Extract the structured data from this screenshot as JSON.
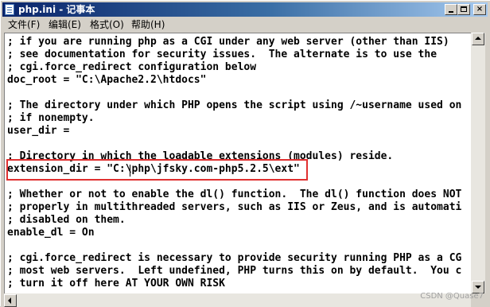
{
  "window": {
    "title": "php.ini - 记事本",
    "minimize_label": "",
    "maximize_label": "",
    "close_label": "×"
  },
  "menu": {
    "items": [
      {
        "label": "文件(F)"
      },
      {
        "label": "编辑(E)"
      },
      {
        "label": "格式(O)"
      },
      {
        "label": "帮助(H)"
      }
    ]
  },
  "editor": {
    "lines": [
      "; if you are running php as a CGI under any web server (other than IIS)",
      "; see documentation for security issues.  The alternate is to use the",
      "; cgi.force_redirect configuration below",
      "doc_root = \"C:\\Apache2.2\\htdocs\"",
      "",
      "; The directory under which PHP opens the script using /~username used on",
      "; if nonempty.",
      "user_dir =",
      "",
      "; Directory in which the loadable extensions (modules) reside.",
      "extension_dir = \"C:\\php\\jfsky.com-php5.2.5\\ext\"",
      "",
      "; Whether or not to enable the dl() function.  The dl() function does NOT",
      "; properly in multithreaded servers, such as IIS or Zeus, and is automati",
      "; disabled on them.",
      "enable_dl = On",
      "",
      "; cgi.force_redirect is necessary to provide security running PHP as a CG",
      "; most web servers.  Left undefined, PHP turns this on by default.  You c",
      "; turn it off here AT YOUR OWN RISK"
    ],
    "highlight_color": "#e03030"
  },
  "watermark": "CSDN @Quase7"
}
